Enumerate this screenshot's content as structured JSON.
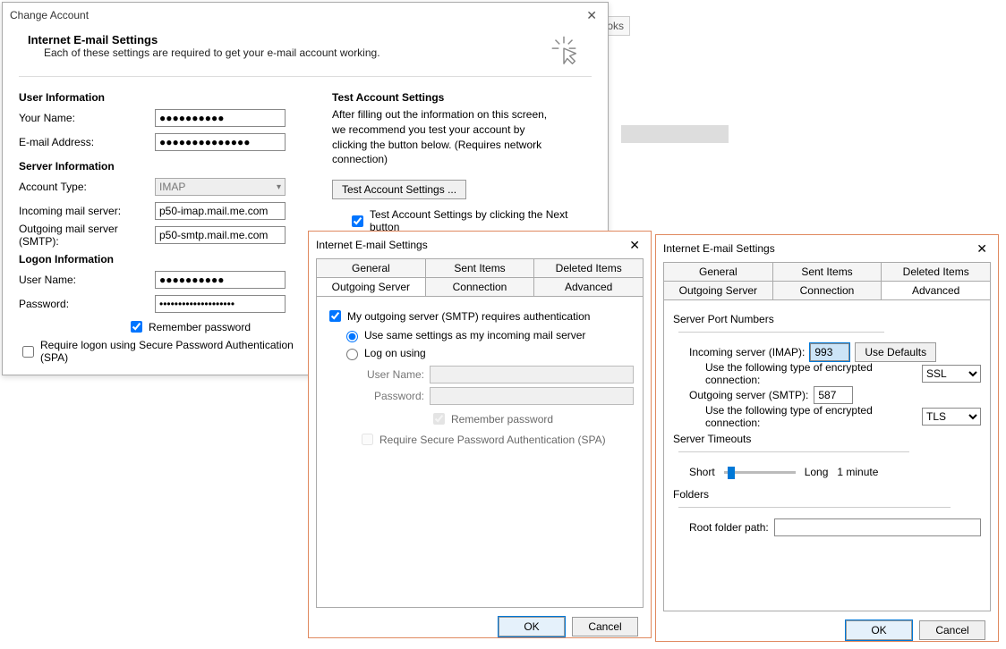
{
  "bg": {
    "ooks": "ooks"
  },
  "main": {
    "title": "Change Account",
    "header_bold": "Internet E-mail Settings",
    "header_sub": "Each of these settings are required to get your e-mail account working.",
    "user_info_heading": "User Information",
    "your_name_label": "Your Name:",
    "your_name_value": "●●●●●●●●●●",
    "email_label": "E-mail Address:",
    "email_value": "●●●●●●●●●●●●●●",
    "server_info_heading": "Server Information",
    "account_type_label": "Account Type:",
    "account_type_value": "IMAP",
    "incoming_label": "Incoming mail server:",
    "incoming_value": "p50-imap.mail.me.com",
    "outgoing_label": "Outgoing mail server (SMTP):",
    "outgoing_value": "p50-smtp.mail.me.com",
    "logon_heading": "Logon Information",
    "user_name_label": "User Name:",
    "user_name_value": "●●●●●●●●●●",
    "password_label": "Password:",
    "password_value": "********************",
    "remember_label": "Remember password",
    "spa_label": "Require logon using Secure Password Authentication (SPA)",
    "test_heading": "Test Account Settings",
    "test_copy": "After filling out the information on this screen, we recommend you test your account by clicking the button below. (Requires network connection)",
    "test_button": "Test Account Settings ...",
    "test_check_label": "Test Account Settings by clicking the Next button"
  },
  "tabs": {
    "general": "General",
    "sent": "Sent Items",
    "deleted": "Deleted Items",
    "outgoing": "Outgoing Server",
    "connection": "Connection",
    "advanced": "Advanced"
  },
  "sd_title": "Internet E-mail Settings",
  "sd1": {
    "chk_main": "My outgoing server (SMTP) requires authentication",
    "radio_same": "Use same settings as my incoming mail server",
    "radio_logon": "Log on using",
    "un_label": "User Name:",
    "pw_label": "Password:",
    "remember": "Remember password",
    "spa": "Require Secure Password Authentication (SPA)"
  },
  "sd2": {
    "ports_heading": "Server Port Numbers",
    "incoming_label": "Incoming server (IMAP):",
    "incoming_value": "993",
    "use_defaults": "Use Defaults",
    "enc_label": "Use the following type of encrypted connection:",
    "enc_in": "SSL",
    "outgoing_label": "Outgoing server (SMTP):",
    "outgoing_value": "587",
    "enc_out": "TLS",
    "timeouts_heading": "Server Timeouts",
    "short": "Short",
    "long": "Long",
    "timeout_val": "1 minute",
    "folders_heading": "Folders",
    "root_label": "Root folder path:",
    "root_value": ""
  },
  "buttons": {
    "ok": "OK",
    "cancel": "Cancel"
  }
}
